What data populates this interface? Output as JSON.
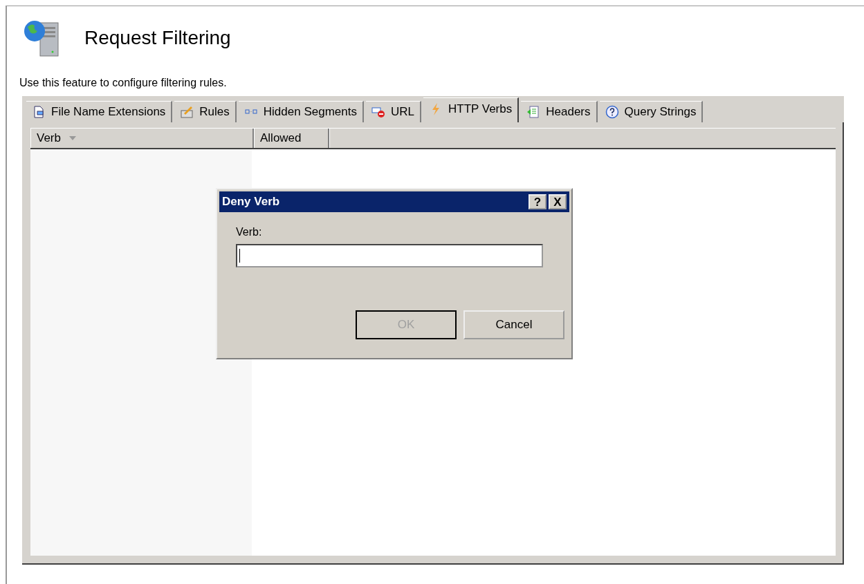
{
  "header": {
    "title": "Request Filtering",
    "description": "Use this feature to configure filtering rules."
  },
  "tabs": [
    {
      "label": "File Name Extensions",
      "kind": "file",
      "selected": false
    },
    {
      "label": "Rules",
      "kind": "rules",
      "selected": false
    },
    {
      "label": "Hidden Segments",
      "kind": "segments",
      "selected": false
    },
    {
      "label": "URL",
      "kind": "url",
      "selected": false
    },
    {
      "label": "HTTP Verbs",
      "kind": "verbs",
      "selected": true
    },
    {
      "label": "Headers",
      "kind": "headers",
      "selected": false
    },
    {
      "label": "Query Strings",
      "kind": "query",
      "selected": false
    }
  ],
  "table": {
    "columns": [
      {
        "label": "Verb",
        "sorted": true
      },
      {
        "label": "Allowed",
        "sorted": false
      }
    ]
  },
  "dialog": {
    "title": "Deny Verb",
    "help_glyph": "?",
    "close_glyph": "X",
    "field_label": "Verb:",
    "buttons": [
      {
        "label": "OK",
        "disabled": true
      },
      {
        "label": "Cancel",
        "disabled": false
      }
    ]
  }
}
